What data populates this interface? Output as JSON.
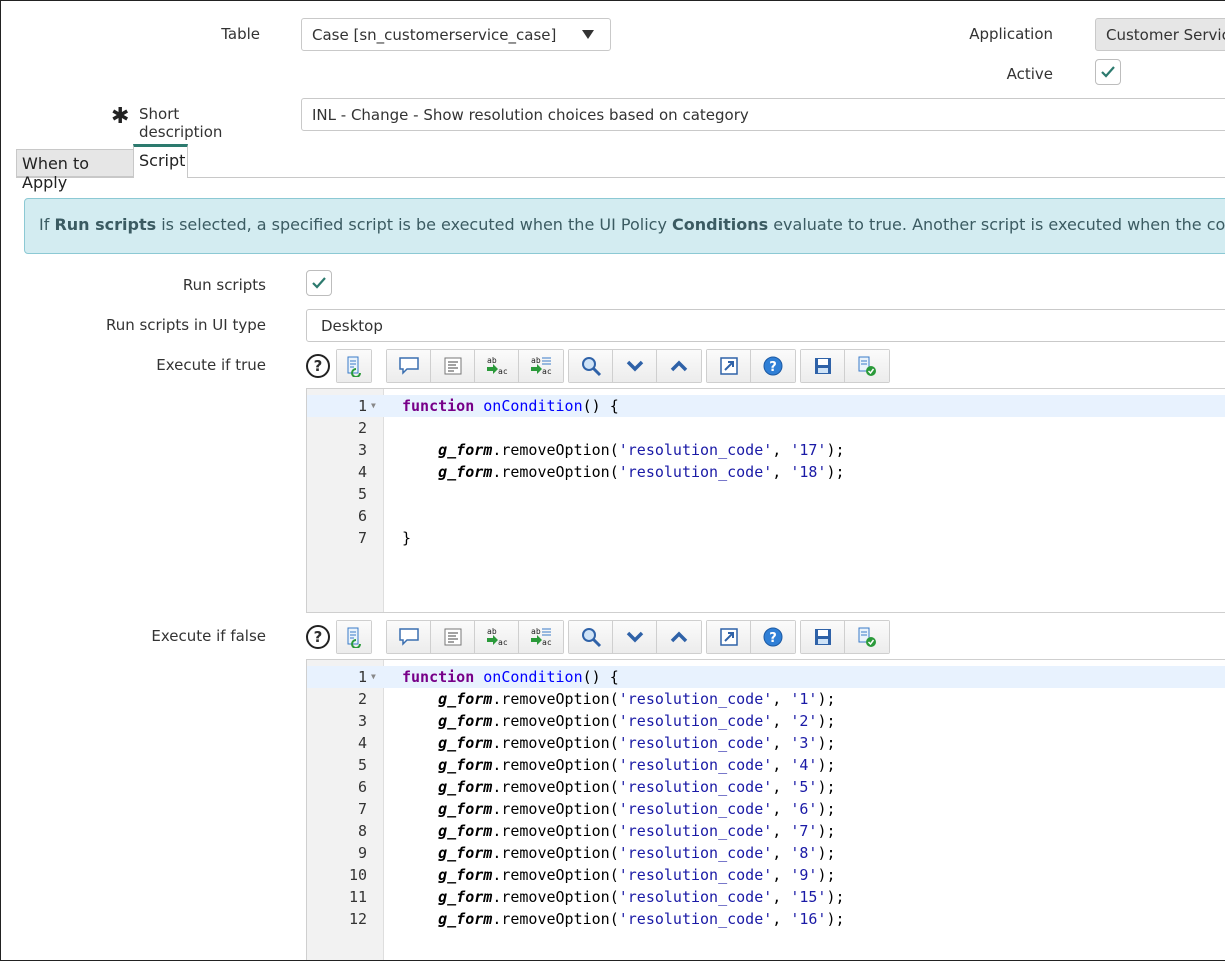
{
  "form": {
    "table_label": "Table",
    "table_value": "Case [sn_customerservice_case]",
    "application_label": "Application",
    "application_value": "Customer Service",
    "active_label": "Active",
    "short_description_label": "Short description",
    "short_description_value": "INL - Change - Show resolution choices based on category",
    "required_marker": "✱"
  },
  "tabs": [
    {
      "label": "When to Apply"
    },
    {
      "label": "Script"
    }
  ],
  "info": {
    "p1": "If ",
    "b1": "Run scripts",
    "p2": " is selected, a specified script is be executed when the UI Policy ",
    "b2": "Conditions",
    "p3": " evaluate to true. Another script is executed when the conditions evaluate to false."
  },
  "script_section": {
    "run_scripts_label": "Run scripts",
    "run_scripts_ui_type_label": "Run scripts in UI type",
    "run_scripts_ui_type_value": "Desktop",
    "execute_true_label": "Execute if true",
    "execute_false_label": "Execute if false"
  },
  "toolbar_icons": [
    "help-icon",
    "script-include-icon",
    "comment-icon",
    "format-code-icon",
    "replace-icon",
    "replace-all-icon",
    "search-icon",
    "find-next-icon",
    "find-previous-icon",
    "fullscreen-icon",
    "context-help-icon",
    "save-icon",
    "script-debugger-icon"
  ],
  "editor_true": {
    "lines": [
      {
        "n": "1",
        "fold": "▼",
        "kw": "function",
        "fn": " onCondition",
        "rest": "() {",
        "hl": true
      },
      {
        "n": "2",
        "code": ""
      },
      {
        "n": "3",
        "opt": "17"
      },
      {
        "n": "4",
        "opt": "18"
      },
      {
        "n": "5",
        "code": ""
      },
      {
        "n": "6",
        "code": ""
      },
      {
        "n": "7",
        "code": "}"
      }
    ]
  },
  "editor_false": {
    "lines": [
      {
        "n": "1",
        "fold": "▼",
        "kw": "function",
        "fn": " onCondition",
        "rest": "() {",
        "hl": true
      },
      {
        "n": "2",
        "opt": "1"
      },
      {
        "n": "3",
        "opt": "2"
      },
      {
        "n": "4",
        "opt": "3"
      },
      {
        "n": "5",
        "opt": "4"
      },
      {
        "n": "6",
        "opt": "5"
      },
      {
        "n": "7",
        "opt": "6"
      },
      {
        "n": "8",
        "opt": "7"
      },
      {
        "n": "9",
        "opt": "8"
      },
      {
        "n": "10",
        "opt": "9"
      },
      {
        "n": "11",
        "opt": "15"
      },
      {
        "n": "12",
        "opt": "16"
      }
    ]
  },
  "code_tokens": {
    "indent": "    ",
    "obj": "g_form",
    "method": ".removeOption(",
    "field": "'resolution_code'",
    "sep": ", ",
    "end": ");"
  },
  "colors": {
    "accent": "#2c7a6e",
    "info_bg": "#d3ecf1",
    "keyword": "#770088",
    "function": "#0000ff",
    "string": "#1a1aa6"
  }
}
